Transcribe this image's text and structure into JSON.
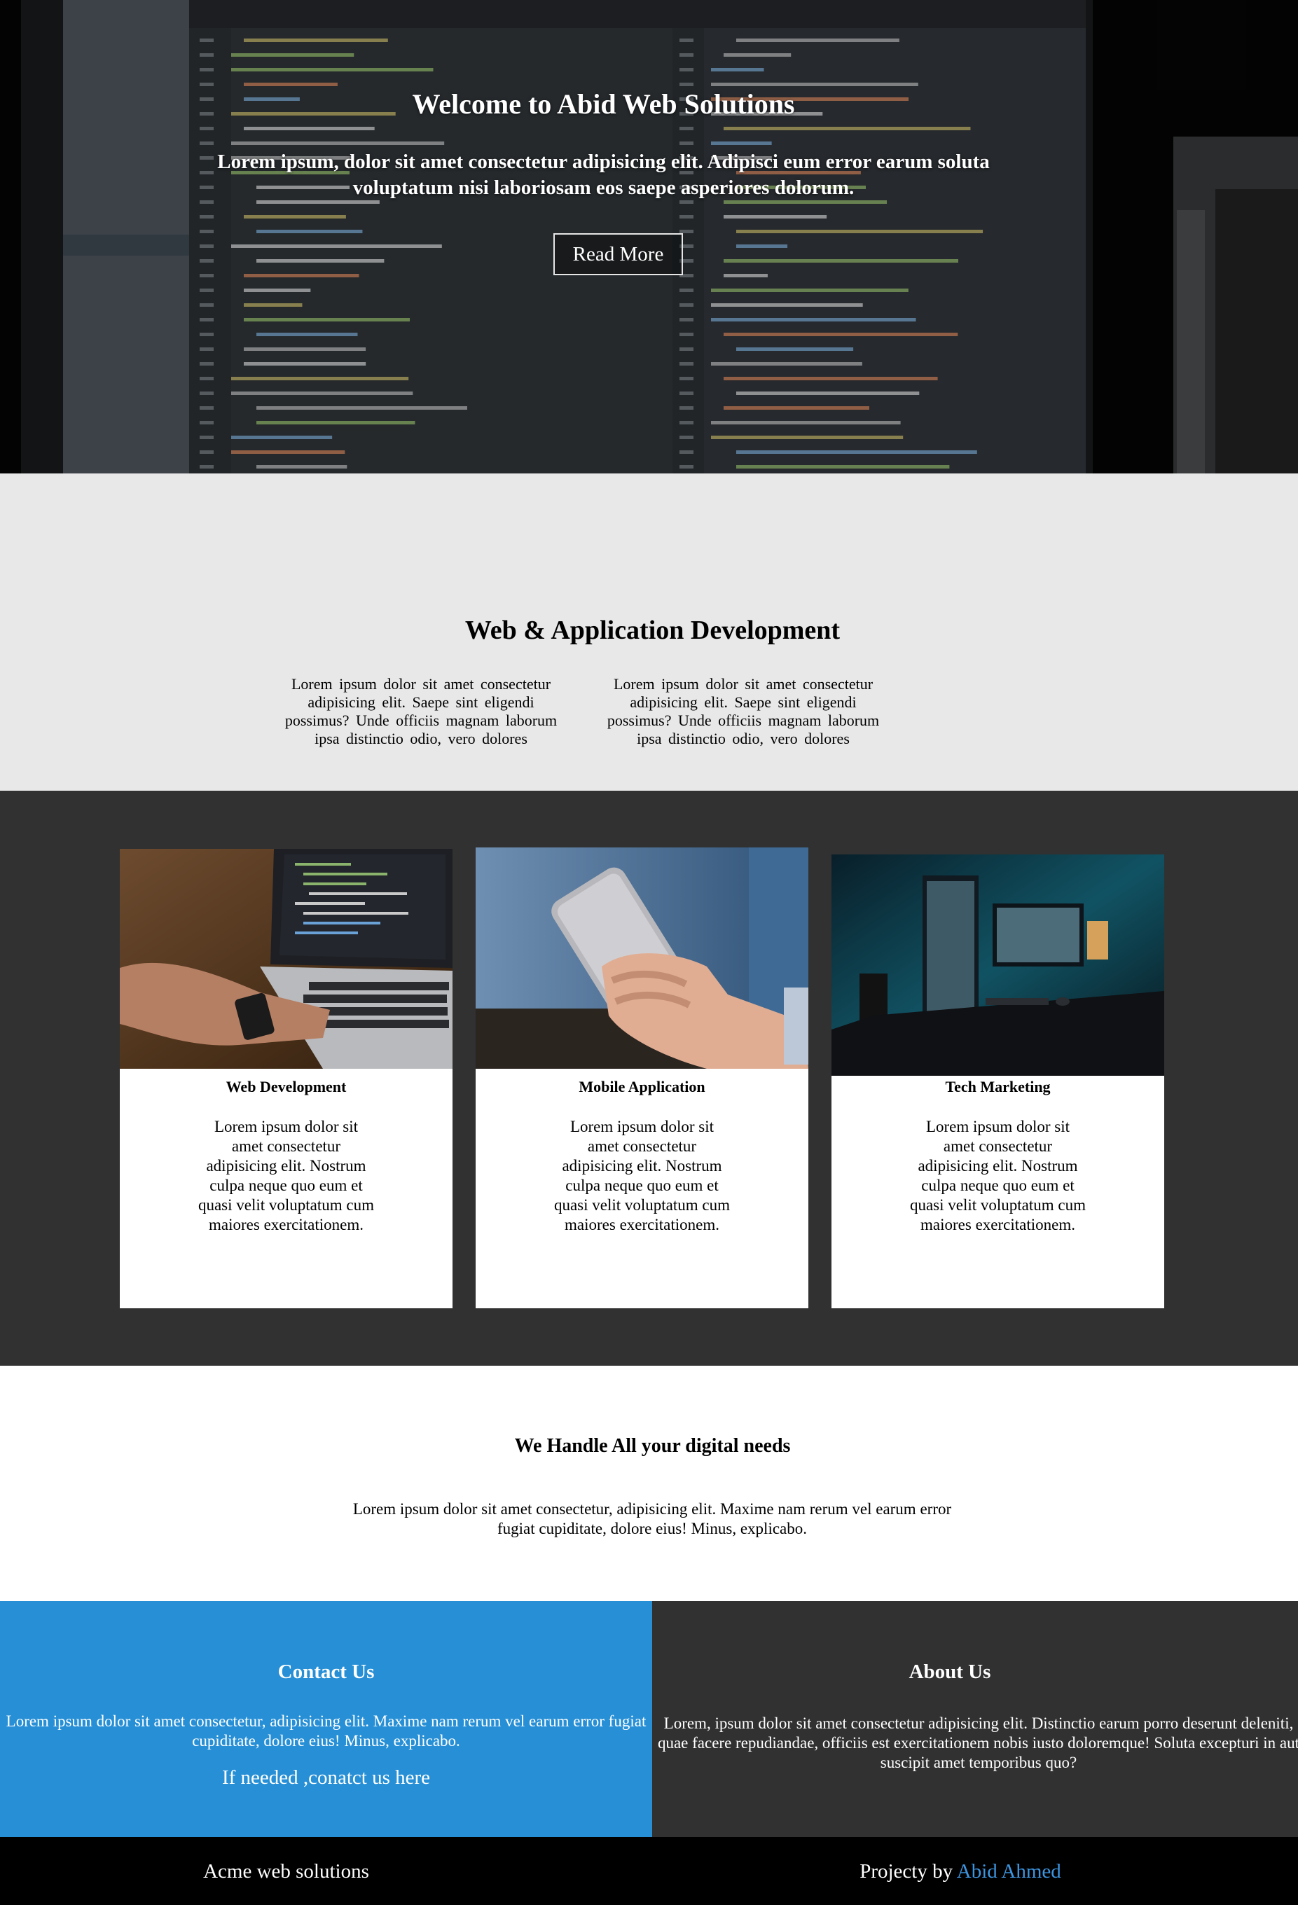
{
  "hero": {
    "title": "Welcome to Abid Web Solutions",
    "subtitle": "Lorem ipsum, dolor sit amet consectetur adipisicing elit. Adipisci eum error earum soluta voluptatum nisi laboriosam eos saepe asperiores dolorum.",
    "button_label": "Read More",
    "background_icon": "code-editor-screen-photo"
  },
  "services_intro": {
    "title": "Web & Application Development",
    "columns": [
      "Lorem ipsum dolor sit amet consectetur adipisicing elit. Saepe sint eligendi possimus? Unde officiis magnam laborum ipsa distinctio odio, vero dolores",
      "Lorem ipsum dolor sit amet consectetur adipisicing elit. Saepe sint eligendi possimus? Unde officiis magnam laborum ipsa distinctio odio, vero dolores"
    ]
  },
  "cards": [
    {
      "title": "Web Development",
      "text": "Lorem ipsum dolor sit amet consectetur adipisicing elit. Nostrum culpa neque quo eum et quasi velit voluptatum cum maiores exercitationem.",
      "image": "laptop-coding-photo"
    },
    {
      "title": "Mobile Application",
      "text": "Lorem ipsum dolor sit amet consectetur adipisicing elit. Nostrum culpa neque quo eum et quasi velit voluptatum cum maiores exercitationem.",
      "image": "smartphone-hand-photo"
    },
    {
      "title": "Tech Marketing",
      "text": "Lorem ipsum dolor sit amet consectetur adipisicing elit. Nostrum culpa neque quo eum et quasi velit voluptatum cum maiores exercitationem.",
      "image": "desk-monitors-photo"
    }
  ],
  "needs": {
    "title": "We Handle All your digital needs",
    "text": "Lorem ipsum dolor sit amet consectetur, adipisicing elit. Maxime nam rerum vel earum error fugiat cupiditate, dolore eius! Minus, explicabo."
  },
  "contact": {
    "title": "Contact Us",
    "text": "Lorem ipsum dolor sit amet consectetur, adipisicing elit. Maxime nam rerum vel earum error fugiat cupiditate, dolore eius! Minus, explicabo.",
    "link_label": "If needed ,conatct us here"
  },
  "about": {
    "title": "About Us",
    "text": "Lorem, ipsum dolor sit amet consectetur adipisicing elit. Distinctio earum porro deserunt deleniti, quae facere repudiandae, officiis est exercitationem nobis iusto doloremque! Soluta excepturi in aut suscipit amet temporibus quo?"
  },
  "footer": {
    "left": "Acme web solutions",
    "right_prefix": "Projecty by ",
    "author": "Abid Ahmed"
  },
  "colors": {
    "contact_bg": "#268fd6",
    "dark_bg": "#313131",
    "light_bg": "#e8e8e8",
    "author_link": "#3d95e0"
  }
}
